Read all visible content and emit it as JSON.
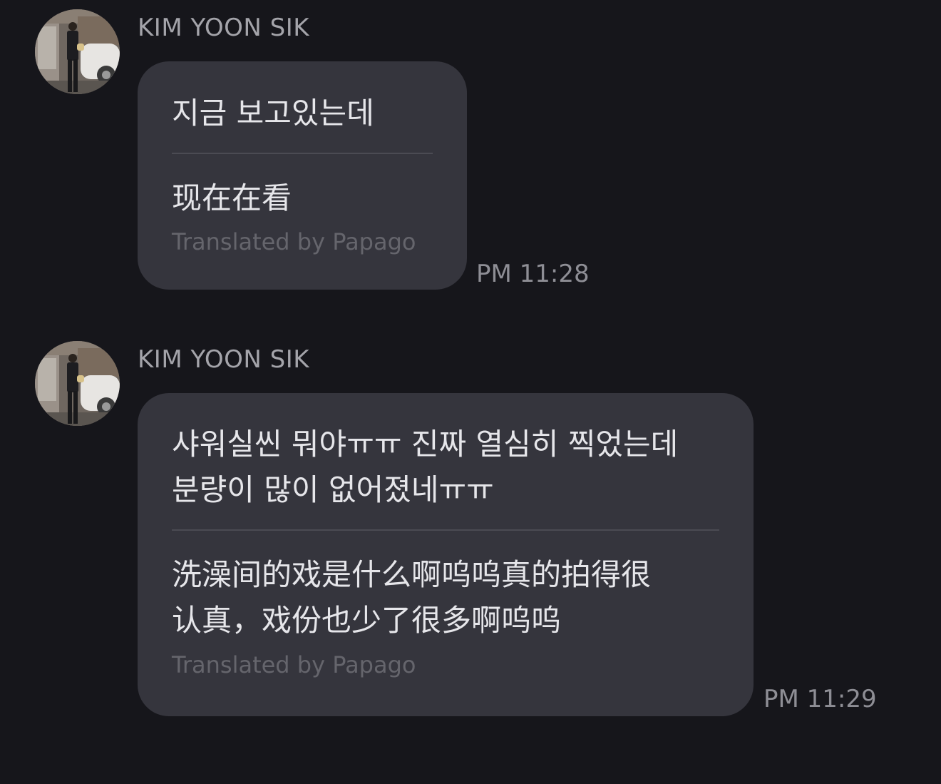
{
  "messages": [
    {
      "sender": "KIM YOON SIK",
      "original_lines": [
        "지금 보고있는데"
      ],
      "translated_lines": [
        "现在在看"
      ],
      "credit": "Translated by Papago",
      "time": "PM 11:28"
    },
    {
      "sender": "KIM YOON SIK",
      "original_lines": [
        "샤워실씬 뭐야ㅠㅠ 진짜 열심히 찍었는데",
        "분량이 많이 없어졌네ㅠㅠ"
      ],
      "translated_lines": [
        "洗澡间的戏是什么啊呜呜真的拍得很",
        "认真，戏份也少了很多啊呜呜"
      ],
      "credit": "Translated by Papago",
      "time": "PM 11:29"
    }
  ],
  "icons": {
    "avatar": "profile-photo-avatar"
  },
  "colors": {
    "background": "#16161b",
    "bubble": "#35353d",
    "message_text": "#e6e6ea",
    "sender_text": "#a4a4aa",
    "credit_text": "#65656c",
    "time_text": "#8e8e95",
    "divider": "#4b4b53"
  }
}
